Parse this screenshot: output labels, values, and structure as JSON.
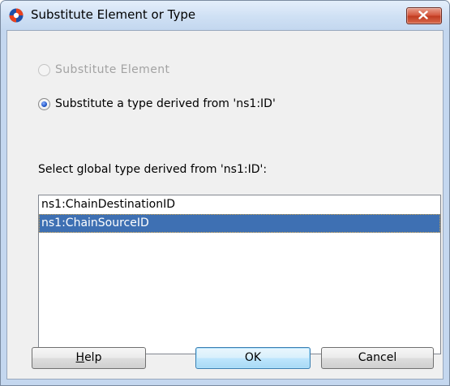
{
  "window": {
    "title": "Substitute Element or Type",
    "close_icon": "close-x-icon",
    "app_icon": "oracle-jdeveloper-icon"
  },
  "options": {
    "substitute_element": {
      "label": "Substitute Element",
      "enabled": false,
      "selected": false
    },
    "substitute_type": {
      "label": "Substitute a type derived from 'ns1:ID'",
      "enabled": true,
      "selected": true
    }
  },
  "select_label": "Select global type derived from 'ns1:ID':",
  "types": [
    {
      "label": "ns1:ChainDestinationID",
      "selected": false
    },
    {
      "label": "ns1:ChainSourceID",
      "selected": true
    }
  ],
  "buttons": {
    "help_mnemonic": "H",
    "help_rest": "elp",
    "ok": "OK",
    "cancel": "Cancel"
  },
  "colors": {
    "title_bar": "#cfe0f4",
    "close_button": "#c9452a",
    "selection": "#3e70b3",
    "dialog_background": "#f0f0f0"
  }
}
